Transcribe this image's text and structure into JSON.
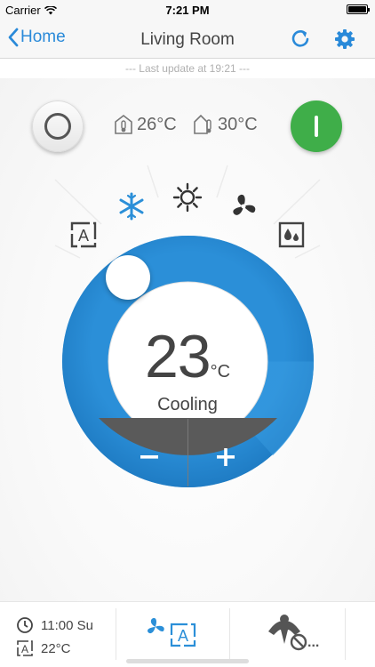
{
  "status_bar": {
    "carrier": "Carrier",
    "time": "7:21 PM"
  },
  "nav": {
    "back_label": "Home",
    "title": "Living Room"
  },
  "last_update": "--- Last update at 19:21 ---",
  "indoor_temp": "26°C",
  "outdoor_temp": "30°C",
  "thermostat": {
    "setpoint": "23",
    "unit": "°C",
    "mode": "Cooling"
  },
  "controls": {
    "minus": "−",
    "plus": "+"
  },
  "schedule": {
    "time": "11:00 Su",
    "temp": "22°C"
  },
  "presence_more": "...",
  "colors": {
    "accent": "#2a8ad9",
    "dial_blue": "#2b8fd8",
    "power_green": "#3fae49",
    "dial_dark": "#5a5a5a"
  },
  "icons": {
    "modes": [
      "auto-mode-icon",
      "cool-mode-icon",
      "heat-mode-icon",
      "fan-mode-icon",
      "dry-mode-icon"
    ],
    "selected_mode": "cool-mode-icon"
  }
}
